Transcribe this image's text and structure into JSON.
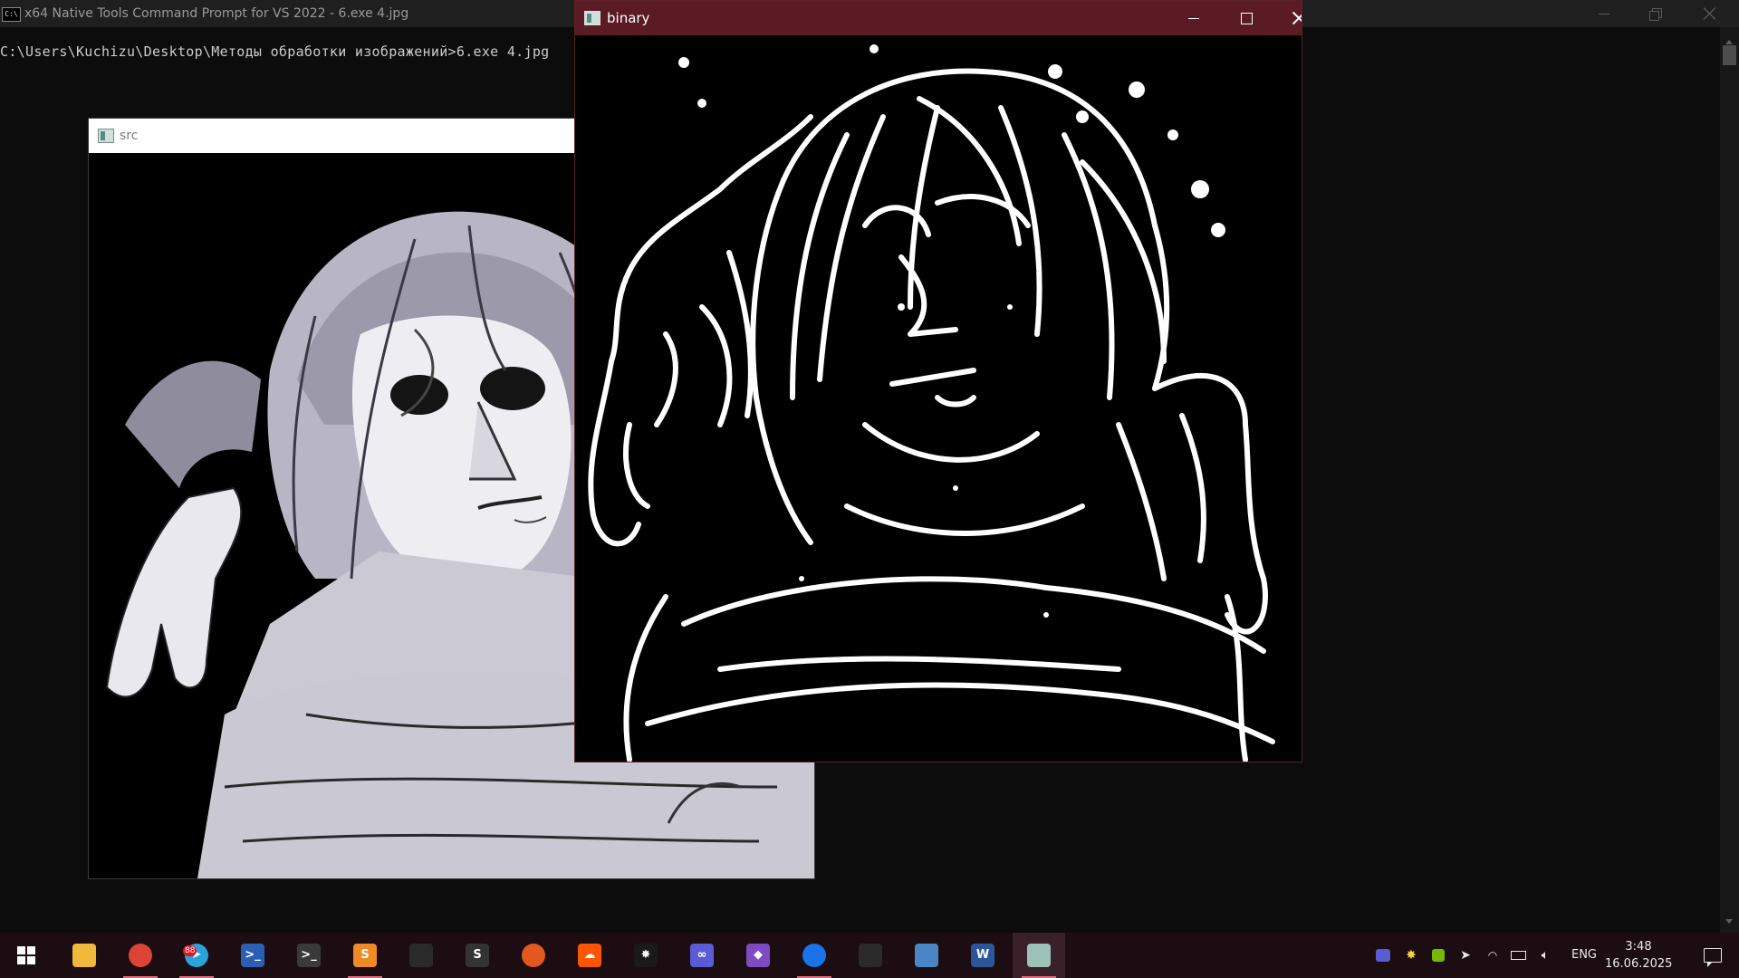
{
  "console": {
    "title": "x64 Native Tools Command Prompt for VS 2022 - 6.exe  4.jpg",
    "icon_text": "C:\\",
    "command_line": "C:\\Users\\Kuchizu\\Desktop\\Методы обработки изображений>6.exe 4.jpg"
  },
  "src_window": {
    "title": "src",
    "image_desc_icon": "image-icon"
  },
  "binary_window": {
    "title": "binary"
  },
  "taskbar": {
    "items": [
      {
        "name": "file-explorer",
        "icon": "folder-icon",
        "glyph": "",
        "color": "#f0b93b"
      },
      {
        "name": "chrome",
        "icon": "chrome-icon",
        "glyph": "",
        "color": "#db4437"
      },
      {
        "name": "telegram",
        "icon": "telegram-icon",
        "glyph": "➤",
        "color": "#2aa3dc",
        "badge": "88"
      },
      {
        "name": "powershell",
        "icon": "powershell-icon",
        "glyph": ">_",
        "color": "#2b5fb4"
      },
      {
        "name": "terminal",
        "icon": "terminal-icon",
        "glyph": ">_",
        "color": "#3a3a3a"
      },
      {
        "name": "sublime-text",
        "icon": "sublime-icon",
        "glyph": "S",
        "color": "#f08a24"
      },
      {
        "name": "console-window",
        "icon": "console-icon",
        "glyph": "",
        "color": "#2a2a2a"
      },
      {
        "name": "app-s",
        "icon": "s-app-icon",
        "glyph": "S",
        "color": "#333333"
      },
      {
        "name": "firefox",
        "icon": "firefox-icon",
        "glyph": "",
        "color": "#e25920"
      },
      {
        "name": "soundcloud",
        "icon": "soundcloud-icon",
        "glyph": "☁",
        "color": "#ff5500"
      },
      {
        "name": "star-app",
        "icon": "spark-icon",
        "glyph": "✸",
        "color": "#1a1a1a"
      },
      {
        "name": "link-app",
        "icon": "link-icon",
        "glyph": "∞",
        "color": "#5b5bd6"
      },
      {
        "name": "visual-studio",
        "icon": "visual-studio-icon",
        "glyph": "◆",
        "color": "#7d4cc2"
      },
      {
        "name": "chrome-profile",
        "icon": "chrome-profile-icon",
        "glyph": "",
        "color": "#1a73e8"
      },
      {
        "name": "console-window-2",
        "icon": "console-icon",
        "glyph": "",
        "color": "#2a2a2a"
      },
      {
        "name": "photos",
        "icon": "photos-icon",
        "glyph": "",
        "color": "#4a86c5"
      },
      {
        "name": "word",
        "icon": "word-icon",
        "glyph": "W",
        "color": "#2b579a"
      },
      {
        "name": "opencv-window",
        "icon": "opencv-window-icon",
        "glyph": "",
        "color": "#9cc2b8"
      }
    ]
  },
  "tray": {
    "language": "ENG",
    "time": "3:48",
    "date": "16.06.2025"
  }
}
